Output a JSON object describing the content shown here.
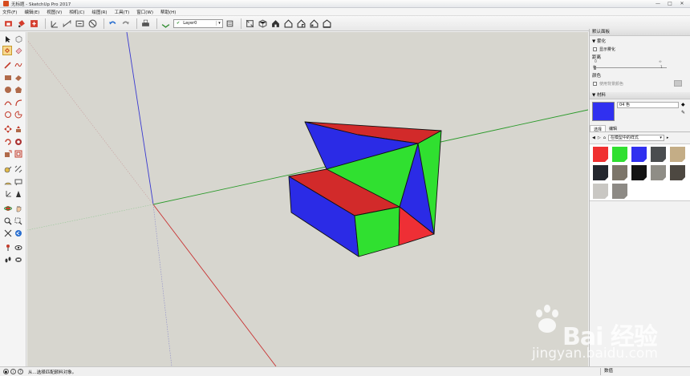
{
  "window": {
    "title": "无标题 - SketchUp Pro 2017",
    "controls": [
      "—",
      "□",
      "✕"
    ]
  },
  "menu": [
    "文件(F)",
    "编辑(E)",
    "视图(V)",
    "相机(C)",
    "绘图(R)",
    "工具(T)",
    "窗口(W)",
    "帮助(H)"
  ],
  "toolbar": {
    "layer": "Layer0"
  },
  "panel": {
    "tray_title": "默认面板",
    "styles_section": "▼ 雾化",
    "show_fog": "显示雾化",
    "distance_label": "距离",
    "start_label": "0",
    "end_label": "∞",
    "unit_label": "0",
    "unit_label2": "1",
    "color_label": "颜色",
    "use_bg_color": "使用背景颜色",
    "materials_section": "▼ 材料",
    "material_name": "04 色",
    "tab_select": "选择",
    "tab_edit": "编辑",
    "library": "在模型中的样式",
    "current_color": "#3030f0",
    "swatches": [
      {
        "name": "red",
        "color": "#f03030"
      },
      {
        "name": "green",
        "color": "#30e030"
      },
      {
        "name": "blue",
        "color": "#3030f0"
      },
      {
        "name": "dark-gray",
        "color": "#4a4d4f"
      },
      {
        "name": "tan",
        "color": "#c4ad86"
      },
      {
        "name": "dark-slate",
        "color": "#24272e"
      },
      {
        "name": "granite",
        "color": "#7d766a"
      },
      {
        "name": "black",
        "color": "#141414"
      },
      {
        "name": "gray-stone",
        "color": "#8f8d86"
      },
      {
        "name": "dark-stone",
        "color": "#4d4841"
      },
      {
        "name": "light-marble",
        "color": "#c9c7c3"
      },
      {
        "name": "speckle",
        "color": "#8d8a85"
      }
    ]
  },
  "status": {
    "hint": "从...选择匹配颜料对象。",
    "measure_label": "数值"
  },
  "watermark": {
    "brand": "Bai 经验",
    "url": "jingyan.baidu.com"
  },
  "colors": {
    "model_red": "#d22a2a",
    "model_green": "#30e030",
    "model_blue": "#2b2be6",
    "viewport_bg": "#d7d6cf"
  }
}
